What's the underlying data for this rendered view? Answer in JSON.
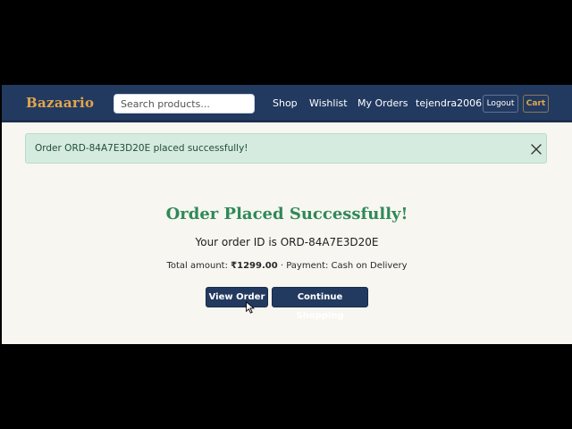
{
  "navbar": {
    "brand": "Bazaario",
    "search_placeholder": "Search products...",
    "links": {
      "shop": "Shop",
      "wishlist": "Wishlist",
      "my_orders": "My Orders",
      "username": "tejendra2006",
      "logout": "Logout",
      "cart": "Cart"
    }
  },
  "alert": {
    "message": "Order ORD-84A7E3D20E placed successfully!"
  },
  "main": {
    "title": "Order Placed Successfully!",
    "order_line": "Your order ID is ORD-84A7E3D20E",
    "amount_label": "Total amount: ",
    "amount_value": "₹1299.00",
    "payment_text": " · Payment: Cash on Delivery",
    "view_order_label": "View Order",
    "continue_label": "Continue Shopping"
  },
  "colors": {
    "navbar": "#233a60",
    "brand_accent": "#e3a64a",
    "success_text": "#2e8a58",
    "alert_bg": "#d6ebe0",
    "page_bg": "#f8f6f0"
  },
  "icons": {
    "alert_close": "close-icon",
    "cursor": "mouse-pointer-icon"
  }
}
